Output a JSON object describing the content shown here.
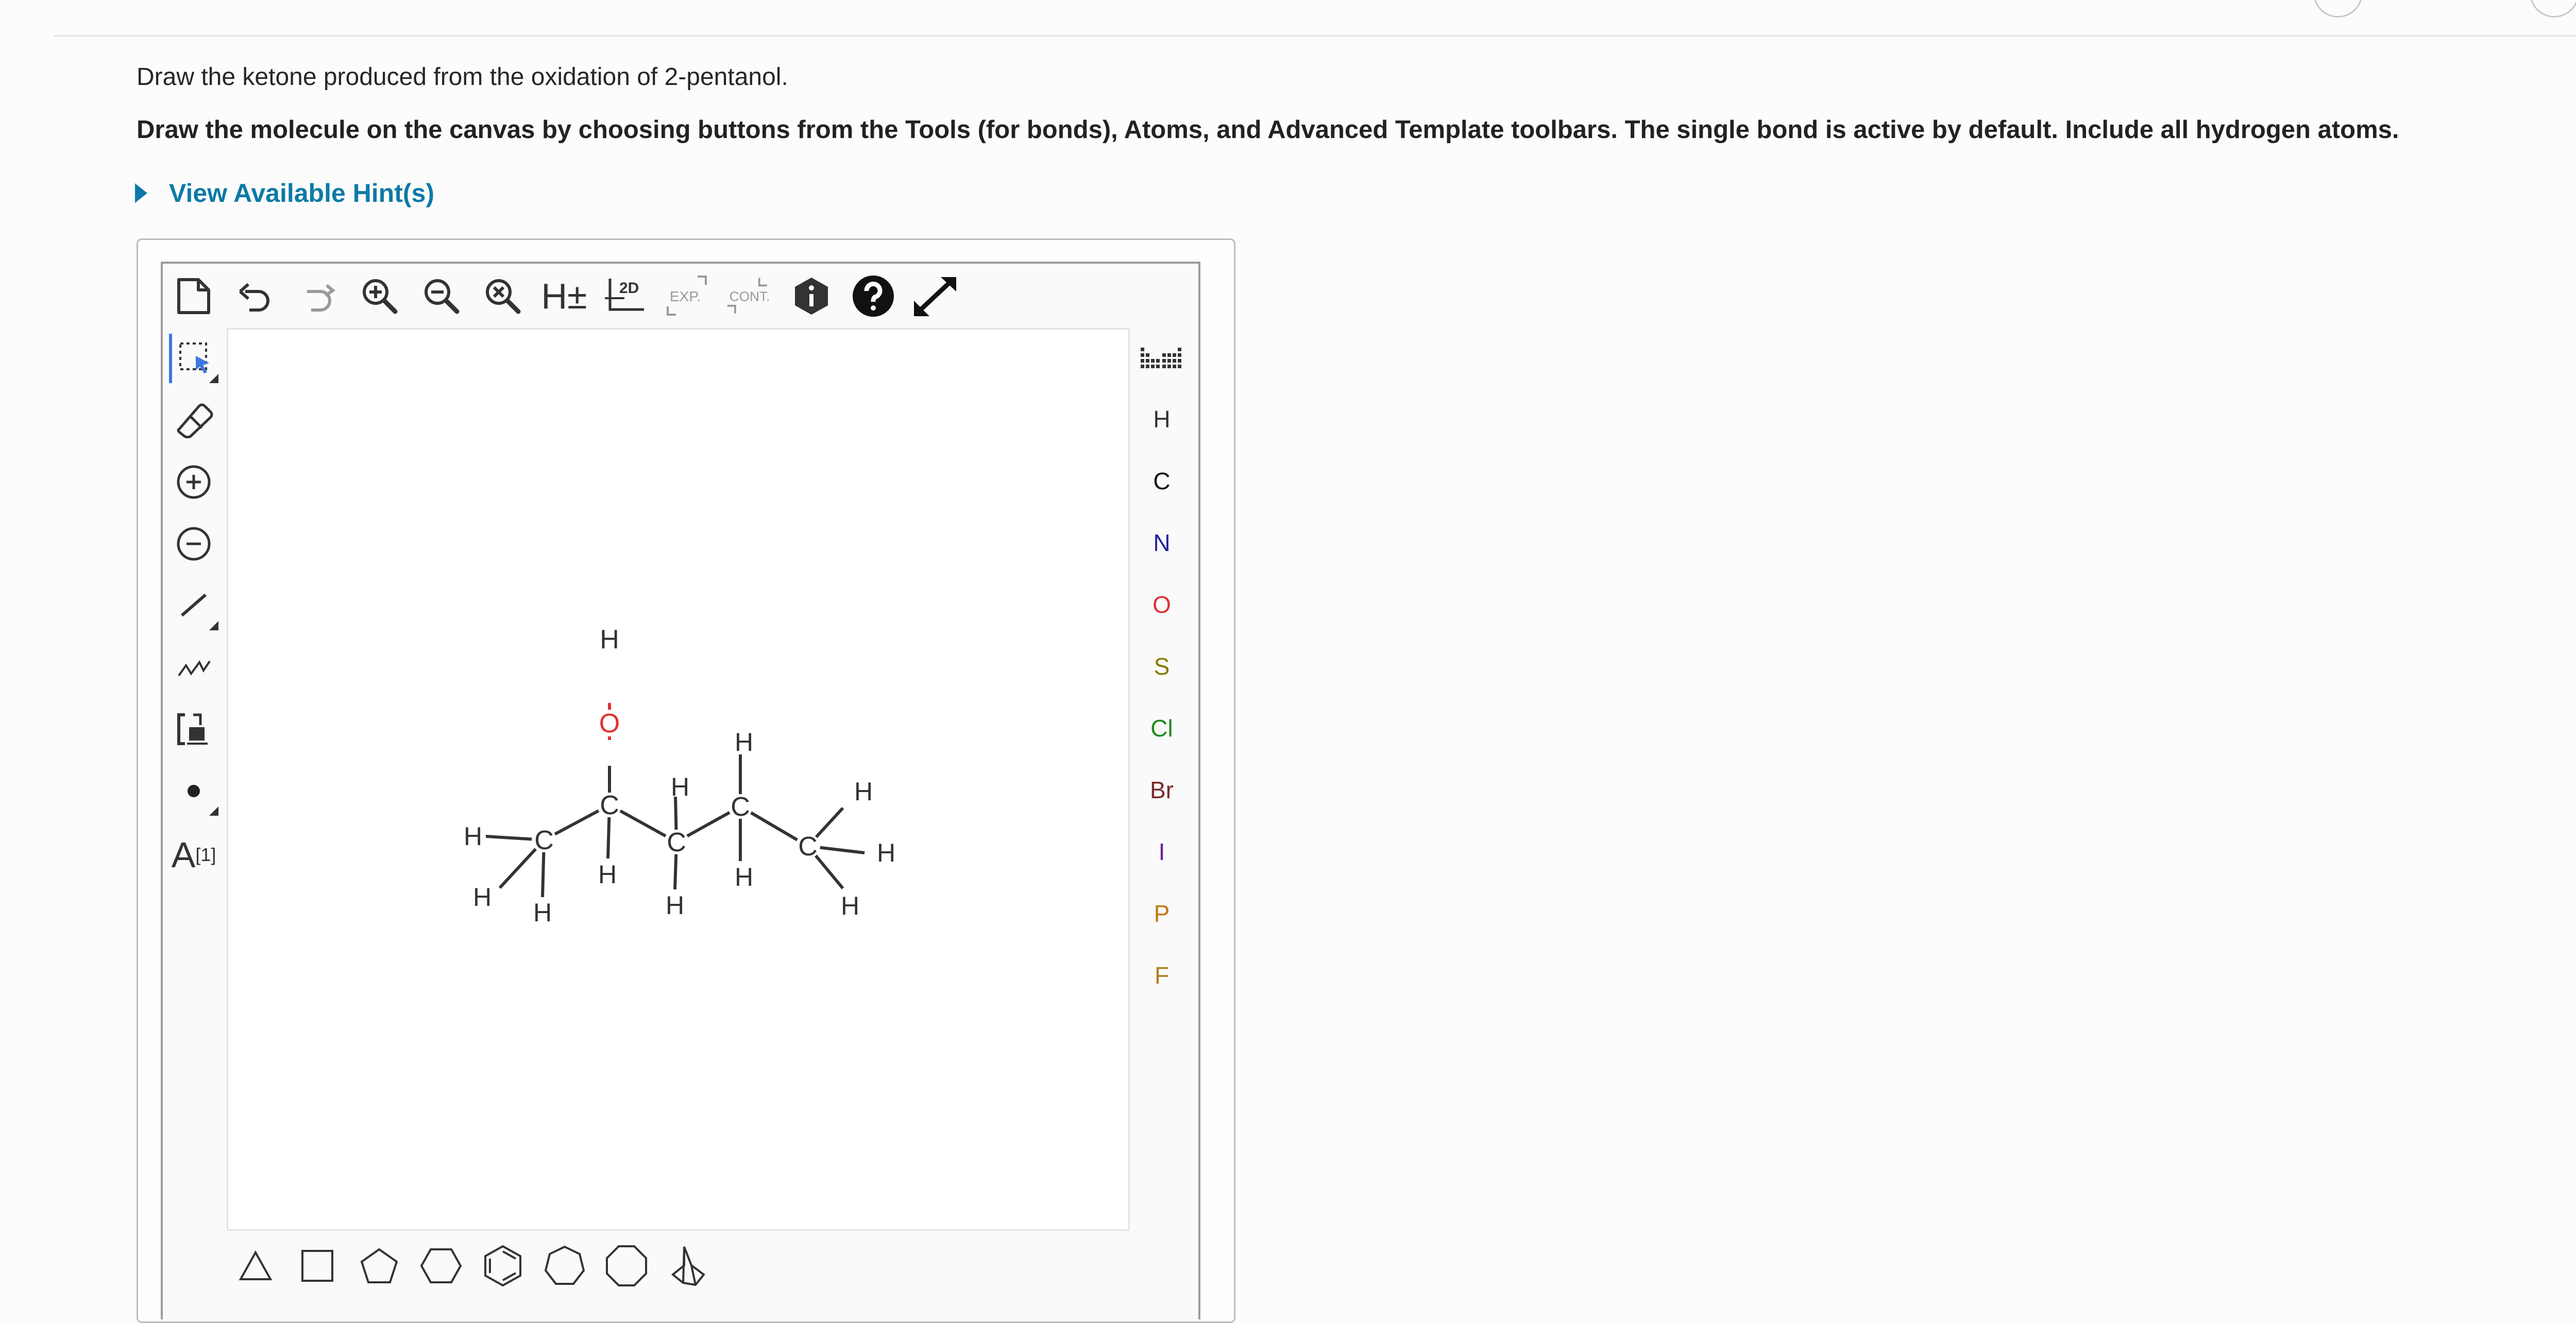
{
  "question": "Draw the ketone produced from the oxidation of 2-pentanol.",
  "instructions": "Draw the molecule on the canvas by choosing buttons from the Tools (for bonds), Atoms, and Advanced Template toolbars. The single bond is active by default. Include all hydrogen atoms.",
  "hints_label": "View Available Hint(s)",
  "toolbar": {
    "hydrogen_label": "H±",
    "clean_2d_label": "2D",
    "expand_label": "EXP.",
    "contract_label": "CONT."
  },
  "left_tools": {
    "text_label": "A",
    "text_sup": "[1]"
  },
  "atoms": [
    {
      "symbol": "H",
      "color": "#333333"
    },
    {
      "symbol": "C",
      "color": "#111111"
    },
    {
      "symbol": "N",
      "color": "#23239a"
    },
    {
      "symbol": "O",
      "color": "#e03030"
    },
    {
      "symbol": "S",
      "color": "#8a7a00"
    },
    {
      "symbol": "Cl",
      "color": "#1e8a1e"
    },
    {
      "symbol": "Br",
      "color": "#7a2a2a"
    },
    {
      "symbol": "I",
      "color": "#6a1ea0"
    },
    {
      "symbol": "P",
      "color": "#c07a10"
    },
    {
      "symbol": "F",
      "color": "#b08020"
    }
  ],
  "molecule": {
    "atoms": [
      {
        "el": "H",
        "color": "#333333"
      },
      {
        "el": "O",
        "color": "#e03030"
      },
      {
        "el": "C",
        "color": "#333333"
      },
      {
        "el": "C",
        "color": "#333333"
      },
      {
        "el": "C",
        "color": "#333333"
      },
      {
        "el": "C",
        "color": "#333333"
      },
      {
        "el": "C",
        "color": "#333333"
      }
    ]
  },
  "colors": {
    "accent": "#0c7aa6",
    "oxygen": "#e03030",
    "selection": "#3c78e0"
  }
}
